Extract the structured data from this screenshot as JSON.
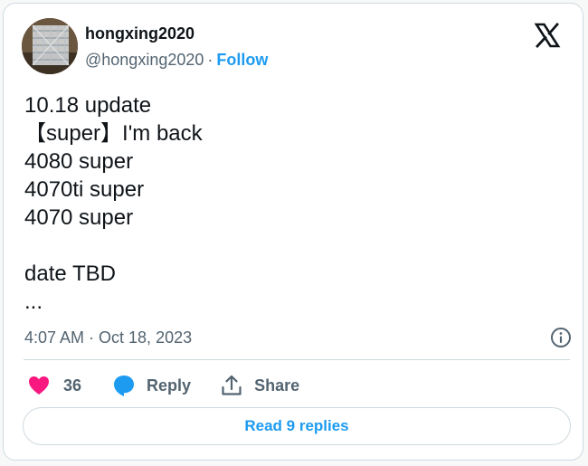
{
  "author": {
    "display_name": "hongxing2020",
    "handle": "@hongxing2020",
    "separator": "·",
    "follow_label": "Follow"
  },
  "logo_icon": "x-logo-icon",
  "tweet": {
    "lines": [
      "10.18 update",
      "【super】I'm back",
      "4080 super",
      "4070ti super",
      "4070 super",
      "",
      "date TBD",
      "..."
    ]
  },
  "meta": {
    "timestamp": "4:07 AM · Oct 18, 2023",
    "info_icon": "info-icon"
  },
  "actions": {
    "like_icon": "heart-icon",
    "like_count": "36",
    "reply_icon": "reply-bubble-icon",
    "reply_label": "Reply",
    "share_icon": "share-icon",
    "share_label": "Share"
  },
  "footer": {
    "read_replies_label": "Read 9 replies"
  },
  "colors": {
    "accent": "#1d9bf0",
    "like": "#f91880",
    "text": "#0f1419",
    "secondary": "#536471",
    "border": "#cfd9de"
  }
}
